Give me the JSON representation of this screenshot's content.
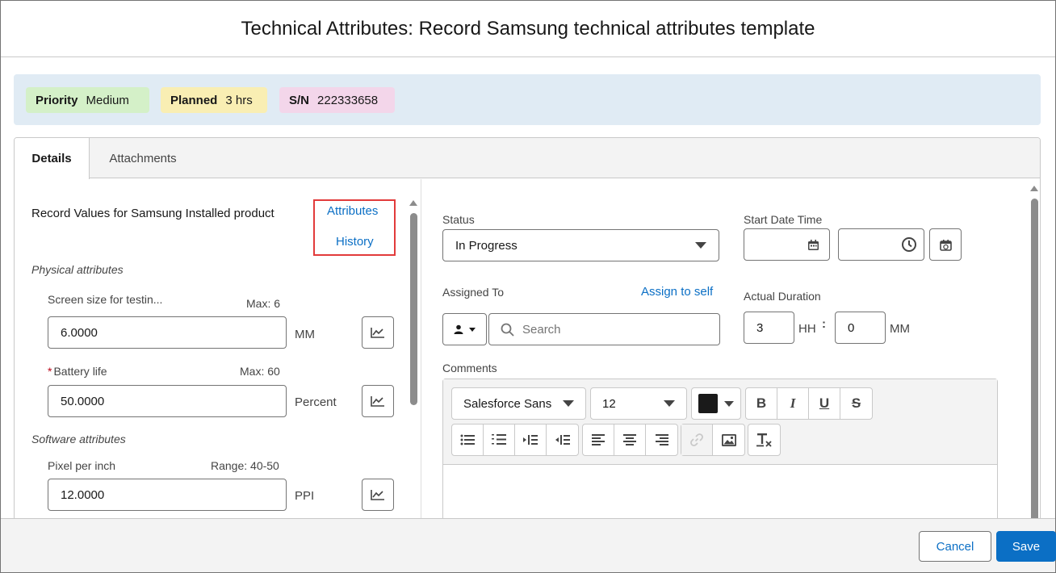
{
  "modal": {
    "title": "Technical Attributes: Record Samsung technical attributes template"
  },
  "highlights": {
    "priority": {
      "label": "Priority",
      "value": "Medium",
      "color": "#d4f0c8"
    },
    "planned": {
      "label": "Planned",
      "value": "3 hrs",
      "color": "#f9eeb3"
    },
    "sn": {
      "label": "S/N",
      "value": "222333658",
      "color": "#f3d6ea"
    }
  },
  "tabs": [
    {
      "label": "Details",
      "active": true
    },
    {
      "label": "Attachments",
      "active": false
    }
  ],
  "left": {
    "heading": "Record Values for Samsung Installed product",
    "links": {
      "attributes": "Attributes",
      "history": "History"
    },
    "sections": [
      {
        "title": "Physical attributes",
        "fields": [
          {
            "label": "Screen size for testin...",
            "limit": "Max: 6",
            "value": "6.0000",
            "unit": "MM",
            "required": false
          },
          {
            "label": "Battery life",
            "limit": "Max: 60",
            "value": "50.0000",
            "unit": "Percent",
            "required": true
          }
        ]
      },
      {
        "title": "Software attributes",
        "fields": [
          {
            "label": "Pixel per inch",
            "limit": "Range: 40-50",
            "value": "12.0000",
            "unit": "PPI",
            "required": false
          }
        ]
      }
    ],
    "required_marker": "*"
  },
  "right": {
    "status": {
      "label": "Status",
      "value": "In Progress"
    },
    "start": {
      "label": "Start Date Time",
      "date_value": "",
      "time_value": ""
    },
    "assigned": {
      "label": "Assigned To",
      "link": "Assign to self",
      "placeholder": "Search"
    },
    "duration": {
      "label": "Actual Duration",
      "hours": "3",
      "hours_unit": "HH",
      "separator": ":",
      "minutes": "0",
      "minutes_unit": "MM"
    },
    "comments": {
      "label": "Comments",
      "font_family": "Salesforce Sans",
      "font_size": "12",
      "text_color": "#1a1a1a",
      "bold": "B",
      "italic": "I",
      "underline": "U",
      "strike": "S"
    }
  },
  "footer": {
    "cancel": "Cancel",
    "save": "Save"
  },
  "colors": {
    "brand": "#0b6fc5",
    "highlight_band": "#e0ebf4",
    "annotation_box": "#e23b3b"
  }
}
